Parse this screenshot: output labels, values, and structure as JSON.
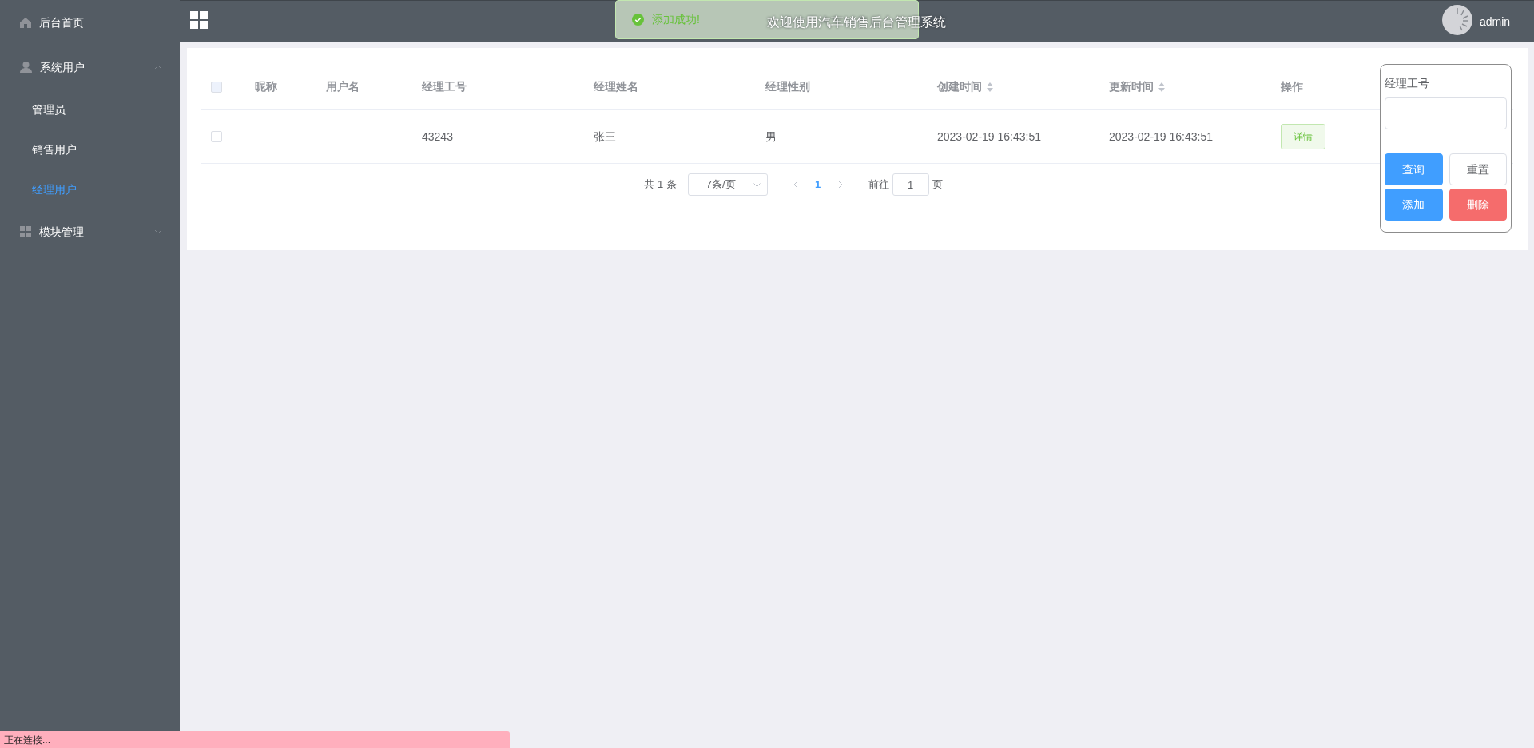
{
  "sidebar": {
    "items": [
      {
        "label": "后台首页",
        "selected": false
      },
      {
        "label": "系统用户",
        "expanded": true,
        "children": [
          {
            "label": "管理员",
            "selected": false
          },
          {
            "label": "销售用户",
            "selected": false
          },
          {
            "label": "经理用户",
            "selected": true
          }
        ]
      },
      {
        "label": "模块管理",
        "expanded": false
      }
    ]
  },
  "header": {
    "title": "欢迎使用汽车销售后台管理系统",
    "user": "admin"
  },
  "toast": {
    "message": "添加成功!"
  },
  "table": {
    "header_checked": false,
    "columns": [
      {
        "label": "昵称",
        "sortable": false
      },
      {
        "label": "用户名",
        "sortable": false
      },
      {
        "label": "经理工号",
        "sortable": false
      },
      {
        "label": "经理姓名",
        "sortable": false
      },
      {
        "label": "经理性别",
        "sortable": false
      },
      {
        "label": "创建时间",
        "sortable": true
      },
      {
        "label": "更新时间",
        "sortable": true
      },
      {
        "label": "操作",
        "sortable": false
      }
    ],
    "rows": [
      {
        "checked": false,
        "employee_no": "43243",
        "name": "张三",
        "gender": "男",
        "created": "2023-02-19 16:43:51",
        "updated": "2023-02-19 16:43:51",
        "action": "详情"
      }
    ]
  },
  "pagination": {
    "total": "共 1 条",
    "page_size": "7条/页",
    "pages": [
      {
        "label": "1",
        "selected": true
      }
    ],
    "goto_label": "前往",
    "goto_value": "1",
    "goto_suffix": "页"
  },
  "search_panel": {
    "label": "经理工号",
    "buttons": [
      {
        "label": "查询",
        "kind": "primary"
      },
      {
        "label": "重置",
        "kind": "default"
      },
      {
        "label": "添加",
        "kind": "primary"
      },
      {
        "label": "删除",
        "kind": "danger"
      }
    ]
  },
  "status_bar": {
    "text": "正在连接..."
  }
}
